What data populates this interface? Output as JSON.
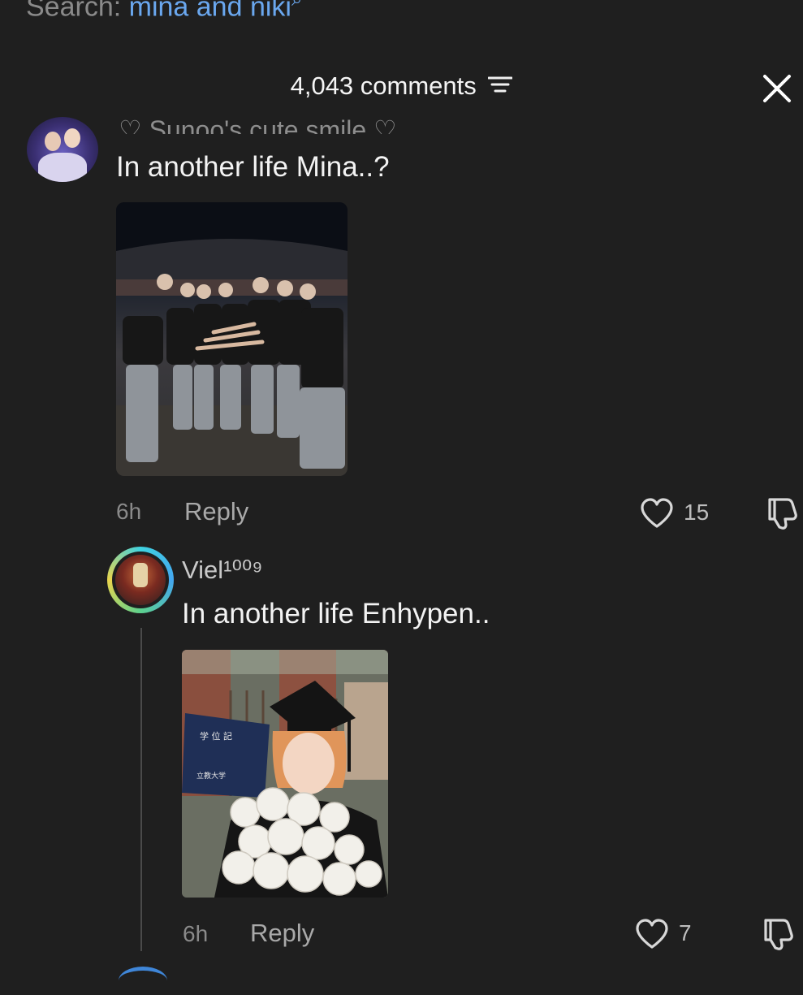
{
  "search": {
    "prefix": "Search: ",
    "query": "mina and niki",
    "icon": "search-icon"
  },
  "header": {
    "count_label": "4,043 comments",
    "sort_icon": "filter-lines-icon",
    "close_icon": "close-icon"
  },
  "comments": [
    {
      "username": "♡ Sunoo's cute smile ♡",
      "text": "In another life Mina..?",
      "time": "6h",
      "reply_label": "Reply",
      "likes": "15",
      "has_photo": true
    }
  ],
  "replies": [
    {
      "username": "Viel¹⁰⁰⁹",
      "text": "In another life Enhypen..",
      "time": "6h",
      "reply_label": "Reply",
      "likes": "7",
      "has_photo": true,
      "photo_text": [
        "学 位 記",
        "立教大学"
      ]
    }
  ],
  "colors": {
    "background": "#1f1f1f",
    "search_accent": "#6aa7ee",
    "muted_text": "#8a8a8a"
  }
}
